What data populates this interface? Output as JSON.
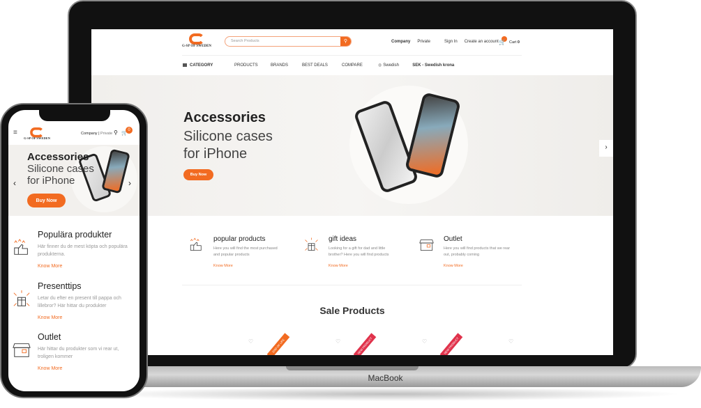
{
  "brand": {
    "name": "G-SP OF SWEDEN",
    "accent": "#f26b21"
  },
  "device_label": "MacBook",
  "desktop": {
    "search_placeholder": "Search Products",
    "top_links": [
      "Company",
      "Private",
      "Sign In",
      "Create an account"
    ],
    "cart_label": "Cart",
    "cart_count": "0",
    "nav": [
      "CATEGORY",
      "PRODUCTS",
      "BRANDS",
      "BEST DEALS",
      "COMPARE"
    ],
    "language": "Swedish",
    "currency": "SEK - Swedish krona",
    "hero": {
      "title": "Accessories",
      "subtitle1": "Silicone cases",
      "subtitle2": "for iPhone",
      "button": "Buy Now"
    },
    "features": [
      {
        "title": "popular products",
        "text": "Here you will find the most purchased and popular products",
        "link": "Know More",
        "icon": "thumbs-up-stars-icon"
      },
      {
        "title": "gift ideas",
        "text": "Looking for a gift for dad and little brother? Here you will find products",
        "link": "Know More",
        "icon": "gift-icon"
      },
      {
        "title": "Outlet",
        "text": "Here you will find products that we rear out, probably coming",
        "link": "Know More",
        "icon": "store-icon"
      }
    ],
    "sale_title": "Sale Products",
    "ribbons": [
      {
        "text": "END OF LIFE",
        "color": "#f26b21"
      },
      {
        "text": "NEW PRODUCT",
        "color": "#e0324b"
      },
      {
        "text": "NEW PRODUCT",
        "color": "#e0324b"
      }
    ]
  },
  "mobile": {
    "top_links": [
      "Company",
      "Private"
    ],
    "cart_count": "0",
    "hero": {
      "title": "Accessories",
      "subtitle1": "Silicone cases",
      "subtitle2": "for iPhone",
      "button": "Buy Now"
    },
    "features": [
      {
        "title": "Populära produkter",
        "text": "Här finner du de mest köpta och populära produkterna.",
        "link": "Know More"
      },
      {
        "title": "Presenttips",
        "text": "Letar du efter en present till pappa och lillebror? Här hittar du produkter",
        "link": "Know More"
      },
      {
        "title": "Outlet",
        "text": "Här hittar du produkter som vi rear ut, troligen kommer",
        "link": "Know More"
      }
    ]
  }
}
